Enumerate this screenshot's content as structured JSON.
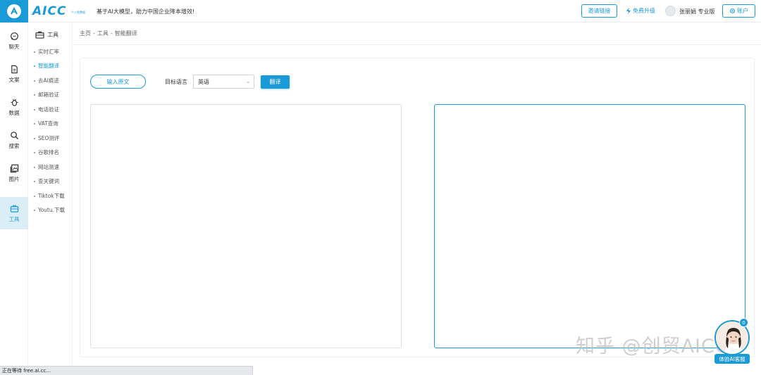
{
  "header": {
    "brand": "AICC",
    "brand_sub": "个人免费版",
    "slogan": "基于AI大模型，助力中国企业降本增效!",
    "invite_label": "邀请链接",
    "upgrade_label": "免费升级",
    "username": "张丽娟 专业版",
    "account_label": "账户"
  },
  "rail": {
    "items": [
      {
        "label": "聊天",
        "icon": "chat-icon"
      },
      {
        "label": "文案",
        "icon": "document-icon"
      },
      {
        "label": "数据",
        "icon": "bug-icon"
      },
      {
        "label": "搜索",
        "icon": "search-icon"
      },
      {
        "label": "图片",
        "icon": "image-icon"
      },
      {
        "label": "工具",
        "icon": "toolbox-icon",
        "active": true
      }
    ]
  },
  "subnav": {
    "title": "工具",
    "items": [
      {
        "label": "实时汇率"
      },
      {
        "label": "智能翻译",
        "active": true
      },
      {
        "label": "去AI痕迹"
      },
      {
        "label": "邮箱验证"
      },
      {
        "label": "电话验证"
      },
      {
        "label": "VAT查询"
      },
      {
        "label": "SEO测评"
      },
      {
        "label": "谷歌排名"
      },
      {
        "label": "网站测速"
      },
      {
        "label": "查关键词"
      },
      {
        "label": "Tiktok下载"
      },
      {
        "label": "Youtu.下载"
      }
    ]
  },
  "breadcrumb": {
    "items": [
      "主页",
      "工具",
      "智能翻译"
    ],
    "separator": "-"
  },
  "translator": {
    "source_button": "输入原文",
    "target_label": "目标语言",
    "target_value": "英语",
    "translate_button": "翻译"
  },
  "watermark": "知乎 @创贸AICC",
  "chat": {
    "badge": "0",
    "label": "体验AI客服"
  },
  "statusbar": "正在等待 free.ai.cc..."
}
